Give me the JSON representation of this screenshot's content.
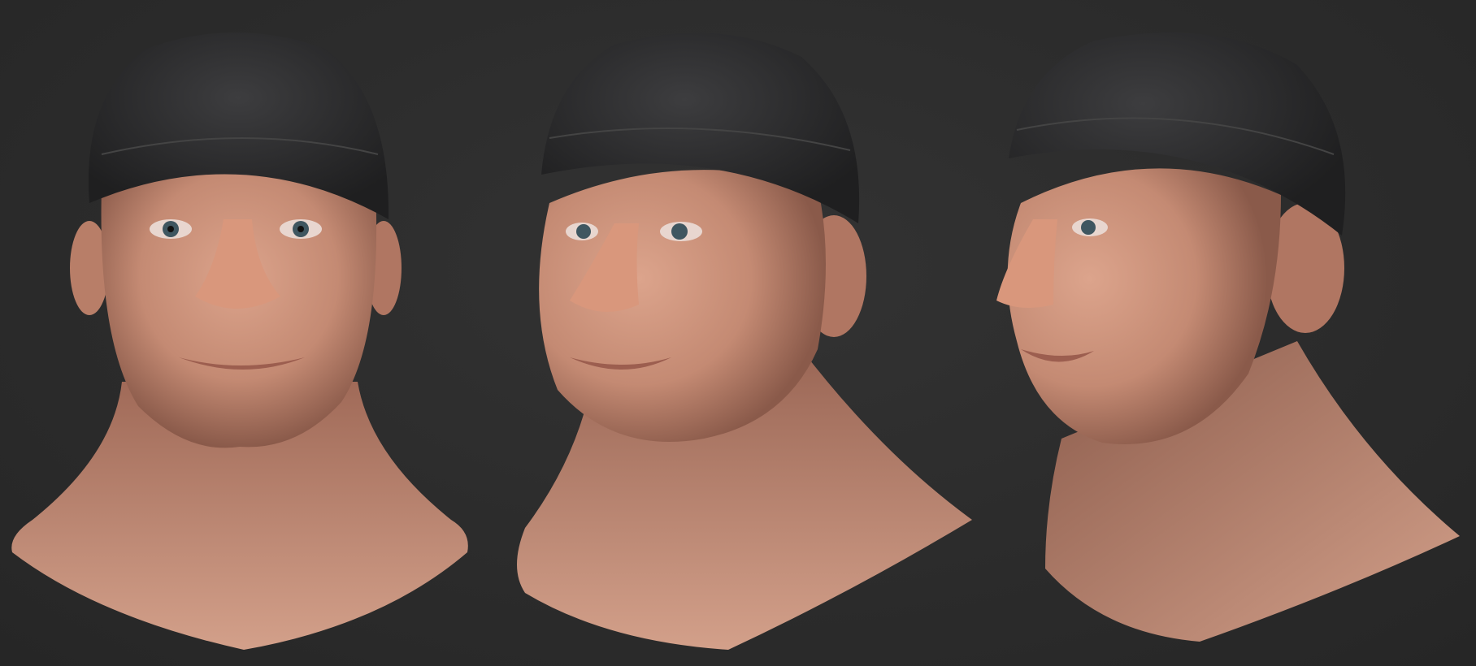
{
  "scene": {
    "background_color": "#2c2c2c",
    "views": [
      {
        "id": "front",
        "label": ""
      },
      {
        "id": "three-quarter",
        "label": ""
      },
      {
        "id": "profile",
        "label": ""
      }
    ]
  },
  "colors": {
    "skin": "#c98f78",
    "skin_shadow": "#8c5c4c",
    "skin_highlight": "#e0ad96",
    "cap": "#2a2a2b",
    "cap_highlight": "#3b3b3d",
    "iris": "#3f5660"
  }
}
